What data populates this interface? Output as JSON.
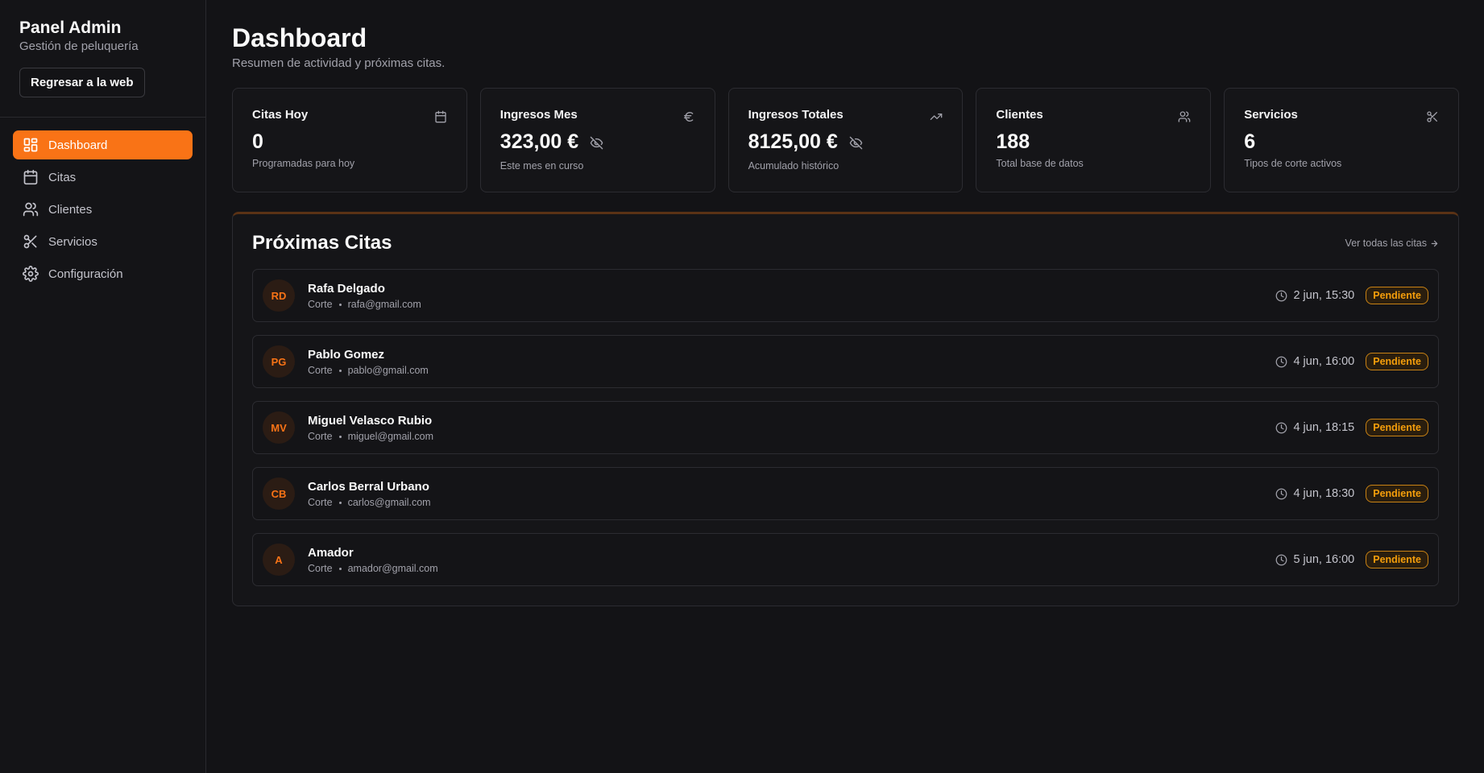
{
  "sidebar": {
    "title": "Panel Admin",
    "subtitle": "Gestión de peluquería",
    "back_button": "Regresar a la web",
    "items": [
      {
        "label": "Dashboard",
        "icon": "dashboard-icon",
        "active": true
      },
      {
        "label": "Citas",
        "icon": "calendar-icon"
      },
      {
        "label": "Clientes",
        "icon": "users-icon"
      },
      {
        "label": "Servicios",
        "icon": "scissors-icon"
      },
      {
        "label": "Configuración",
        "icon": "gear-icon"
      }
    ]
  },
  "header": {
    "title": "Dashboard",
    "subtitle": "Resumen de actividad y próximas citas."
  },
  "stats": [
    {
      "label": "Citas Hoy",
      "value": "0",
      "desc": "Programadas para hoy",
      "icon": "calendar-icon"
    },
    {
      "label": "Ingresos Mes",
      "value": "323,00 €",
      "desc": "Este mes en curso",
      "icon": "euro-icon",
      "hidden_toggle": "eye-off-icon"
    },
    {
      "label": "Ingresos Totales",
      "value": "8125,00 €",
      "desc": "Acumulado histórico",
      "icon": "trending-up-icon",
      "hidden_toggle": "eye-off-icon"
    },
    {
      "label": "Clientes",
      "value": "188",
      "desc": "Total base de datos",
      "icon": "users-icon"
    },
    {
      "label": "Servicios",
      "value": "6",
      "desc": "Tipos de corte activos",
      "icon": "scissors-icon"
    }
  ],
  "appointments": {
    "title": "Próximas Citas",
    "see_all": "Ver todas las citas",
    "rows": [
      {
        "initials": "RD",
        "name": "Rafa Delgado",
        "service": "Corte",
        "email": "rafa@gmail.com",
        "time": "2 jun, 15:30",
        "status": "Pendiente"
      },
      {
        "initials": "PG",
        "name": "Pablo Gomez",
        "service": "Corte",
        "email": "pablo@gmail.com",
        "time": "4 jun, 16:00",
        "status": "Pendiente"
      },
      {
        "initials": "MV",
        "name": "Miguel Velasco Rubio",
        "service": "Corte",
        "email": "miguel@gmail.com",
        "time": "4 jun, 18:15",
        "status": "Pendiente"
      },
      {
        "initials": "CB",
        "name": "Carlos Berral Urbano",
        "service": "Corte",
        "email": "carlos@gmail.com",
        "time": "4 jun, 18:30",
        "status": "Pendiente"
      },
      {
        "initials": "A",
        "name": "Amador",
        "service": "Corte",
        "email": "amador@gmail.com",
        "time": "5 jun, 16:00",
        "status": "Pendiente"
      }
    ]
  },
  "colors": {
    "accent": "#f97316",
    "background": "#131316",
    "card": "#151518",
    "badge_text": "#f59e0b"
  }
}
